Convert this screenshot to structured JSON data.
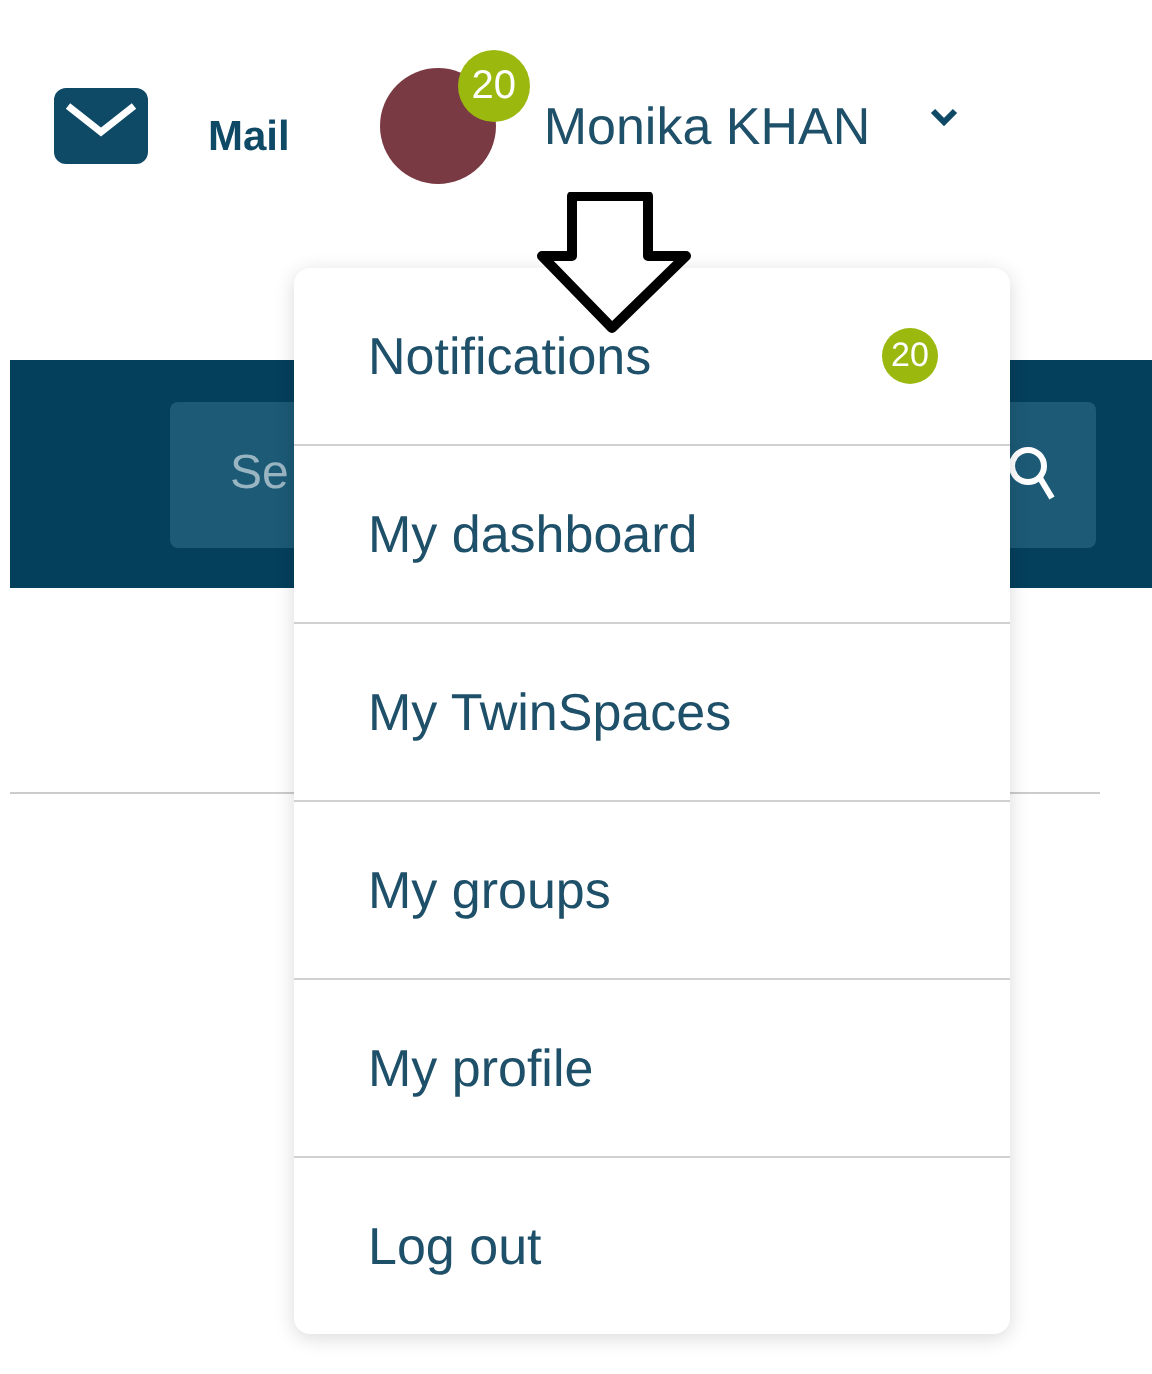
{
  "header": {
    "mail_label": "Mail",
    "user": {
      "name": "Monika KHAN",
      "badge": "20"
    }
  },
  "search": {
    "placeholder": "Se"
  },
  "user_menu": {
    "expanded": true,
    "items": [
      {
        "label": "Notifications",
        "badge": "20"
      },
      {
        "label": "My dashboard"
      },
      {
        "label": "My TwinSpaces"
      },
      {
        "label": "My groups"
      },
      {
        "label": "My profile"
      },
      {
        "label": "Log out"
      }
    ]
  }
}
